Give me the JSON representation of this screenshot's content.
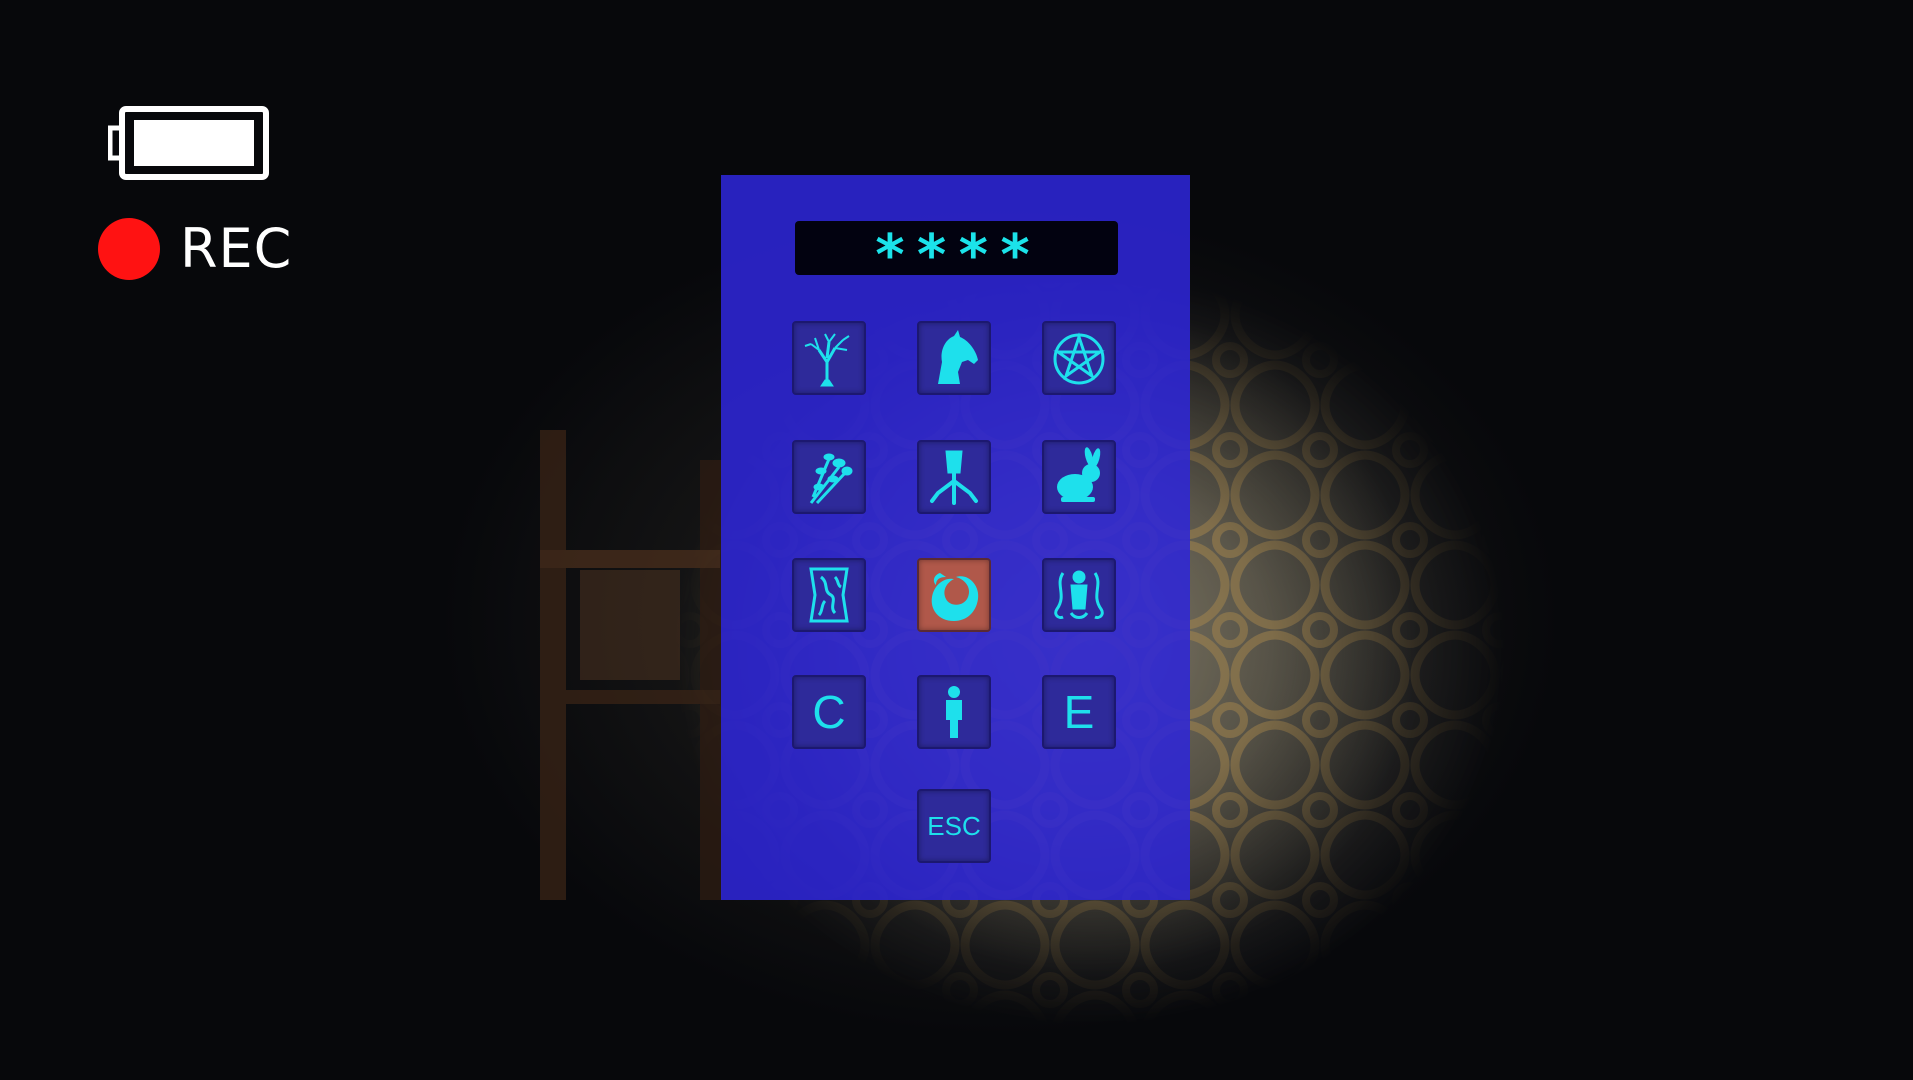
{
  "hud": {
    "battery_level": 1.0,
    "rec_label": "REC",
    "rec_color": "#ff1212"
  },
  "keypad": {
    "code_display": "****",
    "accent_color": "#1ee0ec",
    "selected_color": "#b0584a",
    "panel_color": "#2e26d7",
    "keys": [
      {
        "icon": "tree-icon"
      },
      {
        "icon": "horse-head-icon"
      },
      {
        "icon": "pentagram-icon"
      },
      {
        "icon": "herb-bundle-icon"
      },
      {
        "icon": "bird-claw-icon"
      },
      {
        "icon": "rabbit-icon"
      },
      {
        "icon": "carved-wood-icon"
      },
      {
        "icon": "swirl-icon",
        "selected": true
      },
      {
        "icon": "spirit-figure-icon"
      },
      {
        "label": "C"
      },
      {
        "icon": "person-icon"
      },
      {
        "label": "E"
      }
    ],
    "esc_label": "ESC"
  }
}
